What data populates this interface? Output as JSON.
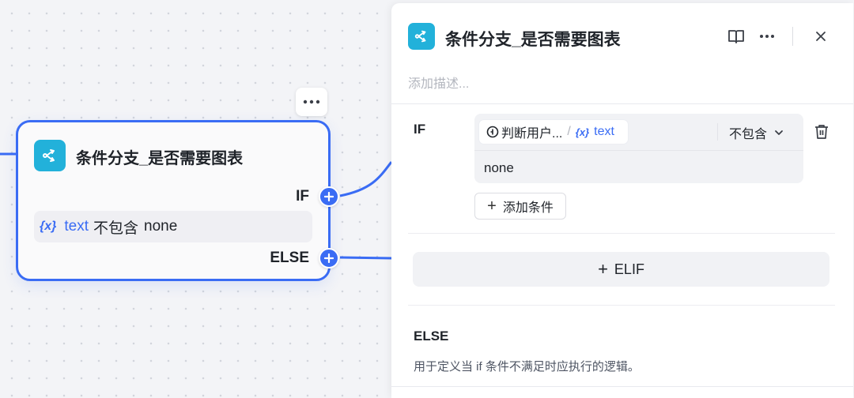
{
  "canvas": {
    "node": {
      "title": "条件分支_是否需要图表",
      "more_label": "···",
      "if_label": "IF",
      "condition": {
        "var_mark": "{x}",
        "var_name": "text",
        "operator": "不包含",
        "value": "none"
      },
      "else_label": "ELSE"
    }
  },
  "panel": {
    "title": "条件分支_是否需要图表",
    "description_placeholder": "添加描述...",
    "if_label": "IF",
    "condition": {
      "source_node": "判断用户...",
      "separator": "/",
      "var_mark": "{x}",
      "var_name": "text",
      "operator": "不包含",
      "value": "none"
    },
    "add_condition_label": "添加条件",
    "elif_label": "ELIF",
    "else_label": "ELSE",
    "else_description": "用于定义当 if 条件不满足时应执行的逻辑。"
  },
  "colors": {
    "accent": "#3a6cf4",
    "icon_bg": "#22b1da"
  },
  "icons": [
    "branch-icon",
    "book-icon",
    "more-icon",
    "close-icon",
    "trash-icon",
    "chevron-down-icon",
    "plus-icon"
  ]
}
